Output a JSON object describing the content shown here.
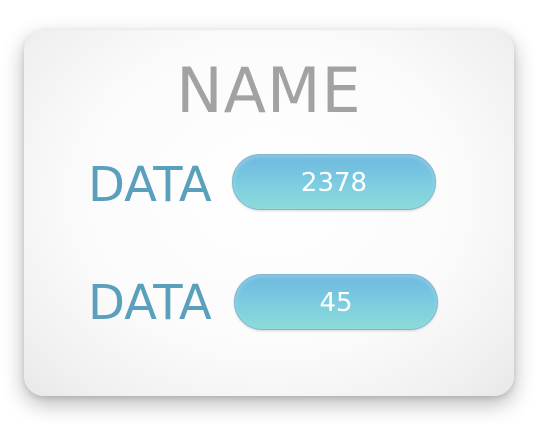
{
  "card": {
    "title": "NAME",
    "rows": [
      {
        "label": "DATA",
        "value": "2378"
      },
      {
        "label": "DATA",
        "value": "45"
      }
    ]
  },
  "colors": {
    "title": "#a2a2a2",
    "label": "#5aa0bd",
    "pill_top": "#6db8df",
    "pill_bottom": "#8ddbd9",
    "pill_text": "#ffffff"
  }
}
